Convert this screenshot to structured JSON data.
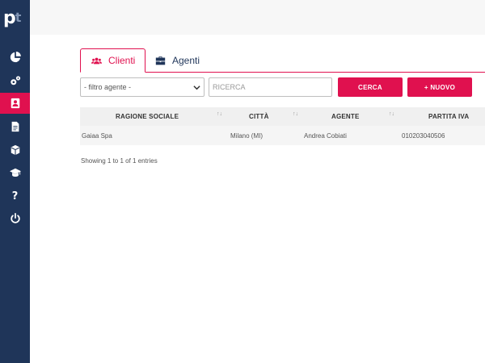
{
  "sidebar": {
    "logo_main": "p",
    "logo_accent": "t",
    "items": [
      {
        "icon": "dashboard-icon"
      },
      {
        "icon": "settings-icon"
      },
      {
        "icon": "contacts-icon",
        "active": true
      },
      {
        "icon": "document-icon"
      },
      {
        "icon": "package-icon"
      },
      {
        "icon": "graduation-cap-icon"
      },
      {
        "icon": "help-icon",
        "glyph": "?"
      },
      {
        "icon": "power-icon"
      }
    ]
  },
  "tabs": [
    {
      "label": "Clienti",
      "icon": "users-icon",
      "active": true
    },
    {
      "label": "Agenti",
      "icon": "briefcase-icon",
      "active": false
    }
  ],
  "filters": {
    "agent_select": "- filtro agente -",
    "search_placeholder": "RICERCA",
    "search_button": "CERCA",
    "new_button": "+ NUOVO"
  },
  "table": {
    "columns": [
      "RAGIONE SOCIALE",
      "CITTÀ",
      "AGENTE",
      "PARTITA IVA"
    ],
    "rows": [
      [
        "Gaiaa Spa",
        "Milano (MI)",
        "Andrea Cobiati",
        "010203040506"
      ]
    ],
    "info": "Showing 1 to 1 of 1 entries"
  },
  "colors": {
    "sidebar_bg": "#1f3559",
    "accent": "#e0114f"
  }
}
